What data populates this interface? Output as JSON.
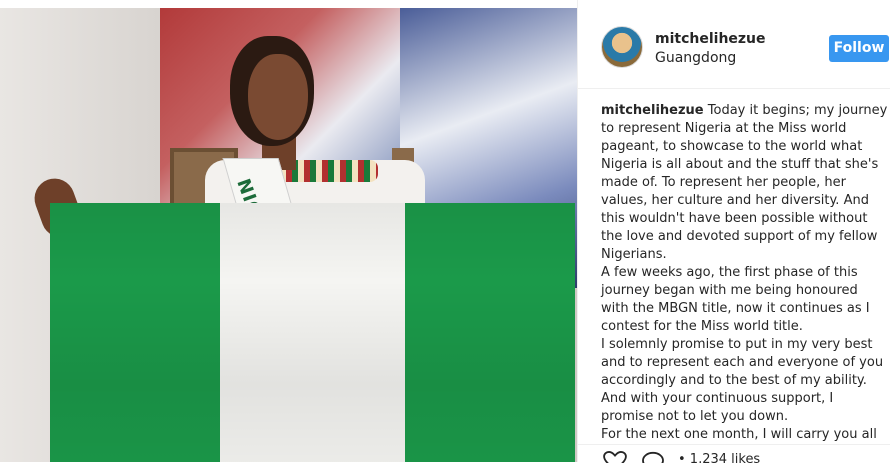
{
  "post": {
    "username": "mitchelihezue",
    "location": "Guangdong",
    "follow_label": "Follow",
    "sash_text": "NIGERIA",
    "caption": {
      "user": "mitchelihezue",
      "p1": "Today it begins; my journey to represent Nigeria at the Miss world pageant, to showcase to the world what Nigeria is all about and the stuff that she's made of. To represent her people, her values, her culture and her diversity. And this wouldn't have been possible without the love and devoted support of my fellow Nigerians.",
      "p2": "A few weeks ago, the first phase of this journey began with me being honoured with the MBGN title, now it continues as I contest for the Miss world title.",
      "p3": "I solemnly promise to put in my very best and to represent each and everyone of you accordingly and to the best of my ability.",
      "p4": "And with your continuous support, I promise not to let you down.",
      "p5": "For the next one month, I will carry you all"
    },
    "actions": {
      "like_icon": "heart-icon",
      "comment_icon": "comment-icon",
      "partial_text": "• 1,234 likes"
    }
  },
  "colors": {
    "follow_bg": "#3897f0",
    "flag_green": "#1b9a4a"
  }
}
